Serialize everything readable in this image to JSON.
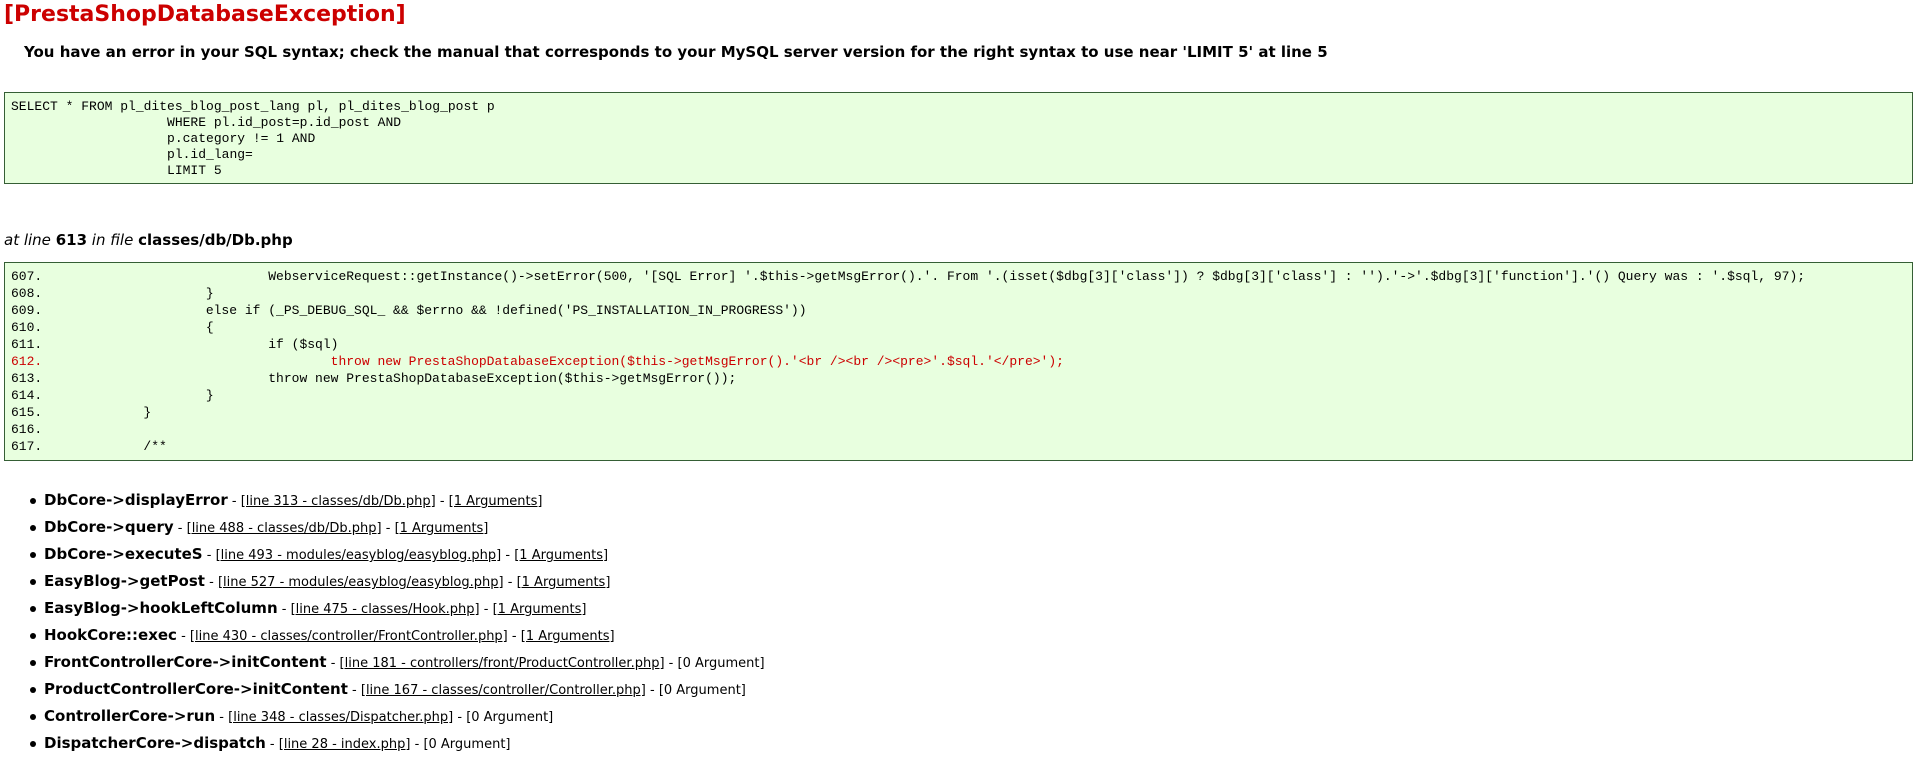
{
  "error": {
    "title": "[PrestaShopDatabaseException]",
    "message": "You have an error in your SQL syntax; check the manual that corresponds to your MySQL server version for the right syntax to use near 'LIMIT 5' at line 5"
  },
  "sql": "SELECT * FROM pl_dites_blog_post_lang pl, pl_dites_blog_post p\n\t\t\t\t\tWHERE pl.id_post=p.id_post AND\n\t\t\t\t\tp.category != 1 AND\n\t\t\t\t\tpl.id_lang=\n\t\t\t\t\tLIMIT 5",
  "location": {
    "prefix": "at line",
    "line": "613",
    "in_file": "in file",
    "file": "classes/db/Db.php"
  },
  "code": [
    {
      "num": "607.",
      "text": "\t\t\tWebserviceRequest::getInstance()->setError(500, '[SQL Error] '.$this->getMsgError().'. From '.(isset($dbg[3]['class']) ? $dbg[3]['class'] : '').'->'.$dbg[3]['function'].'() Query was : '.$sql, 97);",
      "highlight": false
    },
    {
      "num": "608.",
      "text": "\t\t}",
      "highlight": false
    },
    {
      "num": "609.",
      "text": "\t\telse if (_PS_DEBUG_SQL_ && $errno && !defined('PS_INSTALLATION_IN_PROGRESS'))",
      "highlight": false
    },
    {
      "num": "610.",
      "text": "\t\t{",
      "highlight": false
    },
    {
      "num": "611.",
      "text": "\t\t\tif ($sql)",
      "highlight": false
    },
    {
      "num": "612.",
      "text": "\t\t\t\tthrow new PrestaShopDatabaseException($this->getMsgError().'<br /><br /><pre>'.$sql.'</pre>');",
      "highlight": true
    },
    {
      "num": "613.",
      "text": "\t\t\tthrow new PrestaShopDatabaseException($this->getMsgError());",
      "highlight": false
    },
    {
      "num": "614.",
      "text": "\t\t}",
      "highlight": false
    },
    {
      "num": "615.",
      "text": "\t}",
      "highlight": false
    },
    {
      "num": "616.",
      "text": "",
      "highlight": false
    },
    {
      "num": "617.",
      "text": "\t/**",
      "highlight": false
    }
  ],
  "trace": [
    {
      "fn": "DbCore->displayError",
      "link": "[line 313 - classes/db/Db.php]",
      "args": "[1 Arguments]",
      "args_link": true
    },
    {
      "fn": "DbCore->query",
      "link": "[line 488 - classes/db/Db.php]",
      "args": "[1 Arguments]",
      "args_link": true
    },
    {
      "fn": "DbCore->executeS",
      "link": "[line 493 - modules/easyblog/easyblog.php]",
      "args": "[1 Arguments]",
      "args_link": true
    },
    {
      "fn": "EasyBlog->getPost",
      "link": "[line 527 - modules/easyblog/easyblog.php]",
      "args": "[1 Arguments]",
      "args_link": true
    },
    {
      "fn": "EasyBlog->hookLeftColumn",
      "link": "[line 475 - classes/Hook.php]",
      "args": "[1 Arguments]",
      "args_link": true
    },
    {
      "fn": "HookCore::exec",
      "link": "[line 430 - classes/controller/FrontController.php]",
      "args": "[1 Arguments]",
      "args_link": true
    },
    {
      "fn": "FrontControllerCore->initContent",
      "link": "[line 181 - controllers/front/ProductController.php]",
      "args": "[0 Argument]",
      "args_link": false
    },
    {
      "fn": "ProductControllerCore->initContent",
      "link": "[line 167 - classes/controller/Controller.php]",
      "args": "[0 Argument]",
      "args_link": false
    },
    {
      "fn": "ControllerCore->run",
      "link": "[line 348 - classes/Dispatcher.php]",
      "args": "[0 Argument]",
      "args_link": false
    },
    {
      "fn": "DispatcherCore->dispatch",
      "link": "[line 28 - index.php]",
      "args": "[0 Argument]",
      "args_link": false
    }
  ],
  "separator": "-"
}
